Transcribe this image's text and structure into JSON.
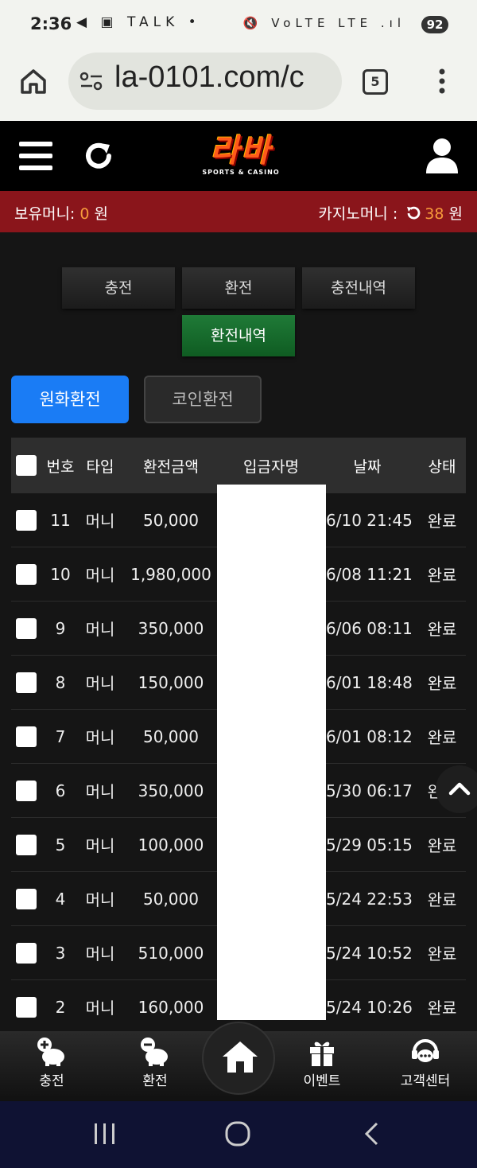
{
  "status_bar": {
    "time": "2:36",
    "icons_left": "◀ ▣ TALK •",
    "icons_right": "🔇 VoLTE LTE .ıl",
    "battery": "92"
  },
  "browser": {
    "url": "la-0101.com/c",
    "tab_count": "5"
  },
  "site": {
    "logo_text": "라바",
    "logo_sub": "SPORTS & CASINO"
  },
  "balance": {
    "holding_label": "보유머니: ",
    "holding_value": "0",
    "holding_unit": " 원",
    "casino_label": "카지노머니 : ",
    "casino_value": "38",
    "casino_unit": " 원"
  },
  "nav_buttons": {
    "deposit": "충전",
    "withdraw": "환전",
    "deposit_history": "충전내역",
    "withdraw_history": "환전내역"
  },
  "exchange_tabs": {
    "krw": "원화환전",
    "coin": "코인환전"
  },
  "table": {
    "headers": {
      "no": "번호",
      "type": "타입",
      "amount": "환전금액",
      "depositor": "입금자명",
      "date": "날짜",
      "status": "상태"
    },
    "rows": [
      {
        "no": "11",
        "type": "머니",
        "amount": "50,000",
        "date": "6/10 21:45",
        "status": "완료"
      },
      {
        "no": "10",
        "type": "머니",
        "amount": "1,980,000",
        "date": "6/08 11:21",
        "status": "완료"
      },
      {
        "no": "9",
        "type": "머니",
        "amount": "350,000",
        "date": "6/06 08:11",
        "status": "완료"
      },
      {
        "no": "8",
        "type": "머니",
        "amount": "150,000",
        "date": "6/01 18:48",
        "status": "완료"
      },
      {
        "no": "7",
        "type": "머니",
        "amount": "50,000",
        "date": "6/01 08:12",
        "status": "완료"
      },
      {
        "no": "6",
        "type": "머니",
        "amount": "350,000",
        "date": "5/30 06:17",
        "status": "완료"
      },
      {
        "no": "5",
        "type": "머니",
        "amount": "100,000",
        "date": "5/29 05:15",
        "status": "완료"
      },
      {
        "no": "4",
        "type": "머니",
        "amount": "50,000",
        "date": "5/24 22:53",
        "status": "완료"
      },
      {
        "no": "3",
        "type": "머니",
        "amount": "510,000",
        "date": "5/24 10:52",
        "status": "완료"
      },
      {
        "no": "2",
        "type": "머니",
        "amount": "160,000",
        "date": "5/24 10:26",
        "status": "완료"
      }
    ]
  },
  "bottom_nav": {
    "deposit": "충전",
    "withdraw": "환전",
    "event": "이벤트",
    "support": "고객센터"
  },
  "colors": {
    "accent_blue": "#1a7cf5",
    "active_green": "#1f7a37",
    "balance_bar": "#8a151b",
    "orange": "#f79b3b"
  }
}
